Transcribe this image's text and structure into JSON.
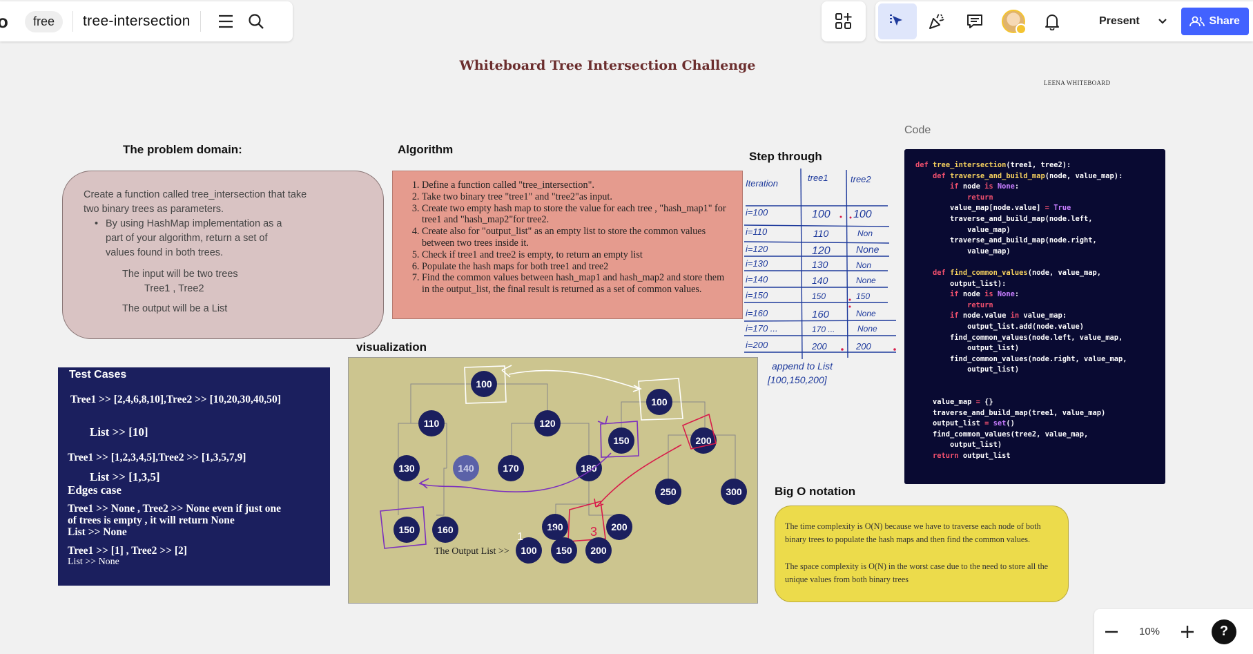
{
  "toolbar": {
    "plan": "free",
    "board_name": "tree-intersection",
    "present_label": "Present",
    "share_label": "Share",
    "zoom_level": "10%",
    "help_label": "?"
  },
  "board": {
    "title": "Whiteboard Tree Intersection Challenge",
    "author": "Leena Whiteboard",
    "problem": {
      "heading": "The problem domain:",
      "line1": "Create a function called tree_intersection that take two binary trees as parameters.",
      "bullet": "By using HashMap implementation as a part of your algorithm, return a set of values found in both trees.",
      "input_line": "The input will be two trees",
      "input_trees": "Tree1 , Tree2",
      "output_line": "The output will be a List"
    },
    "algorithm": {
      "heading": "Algorithm",
      "steps": [
        "Define a function called \"tree_intersection\".",
        "Take two binary tree \"tree1\" and \"tree2\"as input.",
        "Create two empty hash map to store the value for each tree , \"hash_map1\" for tree1 and \"hash_map2\"for tree2.",
        "Create also for \"output_list\" as an empty list  to store the common values between two trees inside it.",
        "Check if tree1 and tree2 is empty, to return an empty list",
        "Populate the hash maps for both tree1 and tree2",
        "Find the common values between hash_map1 and hash_map2 and store them in the output_list, the final result is returned as a set of common values."
      ]
    },
    "tests": {
      "heading": "Test Cases",
      "case1": "Tree1 >> [2,4,6,8,10],Tree2 >> [10,20,30,40,50]",
      "result1": "List  >> [10]",
      "case2": "Tree1 >> [1,2,3,4,5],Tree2 >> [1,3,5,7,9]",
      "result2": "List >> [1,3,5]",
      "edges_heading": "Edges case",
      "edge1a": "Tree1 >> None , Tree2 >> None even if just one",
      "edge1b": "of trees is empty , it will return None",
      "edge1c": "List >> None",
      "edge2a": "Tree1 >> [1] , Tree2 >> [2]",
      "edge2b": "List >> None"
    },
    "visualization": {
      "heading": "visualization",
      "tree1": [
        "100",
        "110",
        "120",
        "130",
        "140",
        "170",
        "180",
        "150",
        "160",
        "190",
        "200"
      ],
      "tree2": [
        "100",
        "150",
        "200",
        "250",
        "300"
      ],
      "output_label": "The Output List >>",
      "output": [
        "100",
        "150",
        "200"
      ],
      "hand_numbers": [
        "1",
        "2",
        "3"
      ],
      "colors": {
        "node": "#1b1f5e",
        "highlight_node": "#5b62a8",
        "purple": "#7b2fbe",
        "red": "#d81b4a"
      }
    },
    "step_through": {
      "heading": "Step through",
      "headers": [
        "Iteration",
        "tree1",
        "tree2"
      ],
      "rows": [
        [
          "i=100",
          "100",
          "100"
        ],
        [
          "i=110",
          "110",
          "Non"
        ],
        [
          "i=120",
          "120",
          "None"
        ],
        [
          "i=130",
          "130",
          "Non"
        ],
        [
          "i=140",
          "140",
          "None"
        ],
        [
          "i=150",
          "150",
          "150"
        ],
        [
          "i=160",
          "160",
          "None"
        ],
        [
          "i=170 ...",
          "170 ...",
          "None"
        ],
        [
          "i=200",
          "200",
          "200"
        ]
      ],
      "note1": "append to List",
      "note2": "[100,150,200]"
    },
    "code": {
      "label": "Code"
    },
    "bigo": {
      "heading": "Big O notation",
      "p1": "The time complexity is O(N) because we have to traverse each node of both binary trees to populate the hash maps and then find the common values.",
      "p2": "The space complexity is O(N) in the worst case due to the need to store all the unique values from both binary trees"
    }
  }
}
